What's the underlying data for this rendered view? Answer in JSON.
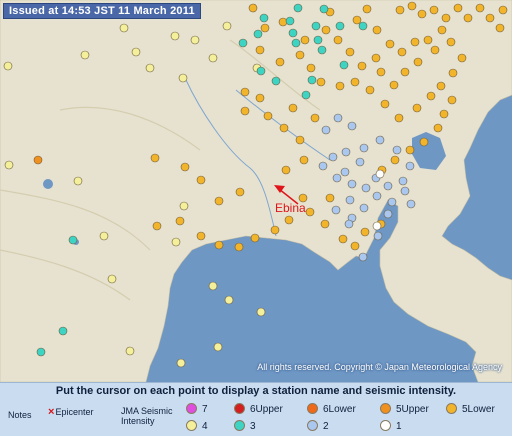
{
  "header": {
    "issued": "Issued at 14:53 JST  11 March 2011"
  },
  "map": {
    "copyright": "All rights reserved. Copyright © Japan Meteorological Agency",
    "annotation": "Ebina"
  },
  "panel": {
    "instruction": "Put the cursor on each point to display a station name and seismic intensity.",
    "notes_label": "Notes",
    "epicenter_label": "Epicenter",
    "scale_title_1": "JMA Seismic",
    "scale_title_2": "Intensity",
    "legend": [
      {
        "label": "7",
        "color": "#e04ee0"
      },
      {
        "label": "6Upper",
        "color": "#d21f1f"
      },
      {
        "label": "6Lower",
        "color": "#ee6a1a"
      },
      {
        "label": "5Upper",
        "color": "#f0901f"
      },
      {
        "label": "5Lower",
        "color": "#f2b42a"
      },
      {
        "label": "4",
        "color": "#f4ef9a"
      },
      {
        "label": "3",
        "color": "#3dd4c4"
      },
      {
        "label": "2",
        "color": "#a9c7ef"
      },
      {
        "label": "1",
        "color": "#ffffff"
      }
    ]
  },
  "stations_by_intensity": {
    "5Lower": 88,
    "5Upper": 1,
    "4": 27,
    "3": 21,
    "2": 30,
    "1": 2
  }
}
